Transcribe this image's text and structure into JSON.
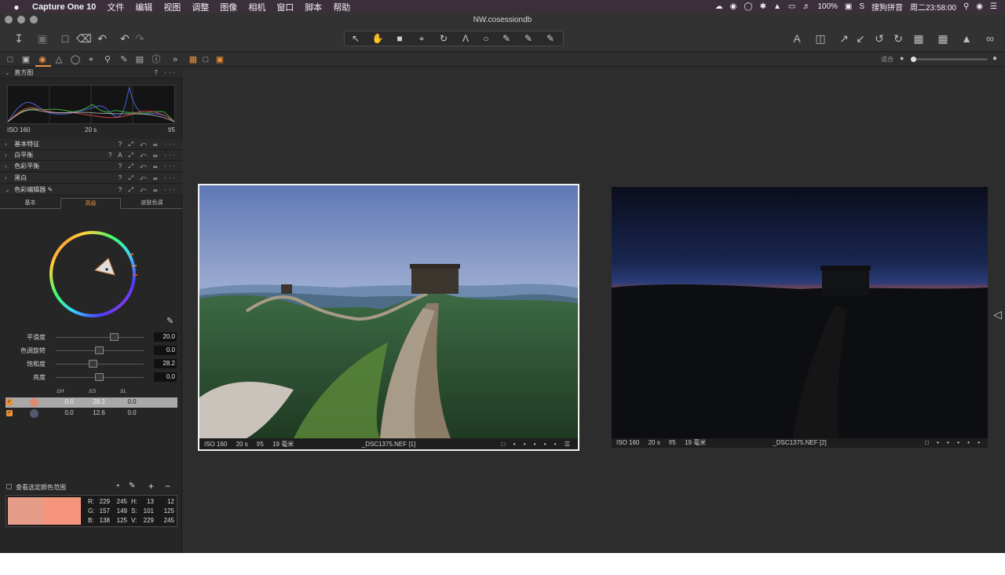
{
  "menubar": {
    "apple": "",
    "app_name": "Capture One 10",
    "menus": [
      "文件",
      "编辑",
      "视图",
      "调整",
      "图像",
      "相机",
      "窗口",
      "脚本",
      "帮助"
    ],
    "battery": "100%",
    "input_method": "搜狗拼音",
    "clock": "周二23:58:00"
  },
  "window": {
    "title": "NW.cosessiondb"
  },
  "colors": {
    "accent": "#e8913a",
    "menubar_bg": "#3a2f3a",
    "panel_bg": "#262626"
  },
  "viewer_bar": {
    "fit_label": "适合"
  },
  "histogram": {
    "title": "直方图",
    "iso": "ISO 160",
    "shutter": "20 s",
    "aperture": "f/5"
  },
  "sections": [
    {
      "title": "基本特征"
    },
    {
      "title": "白平衡"
    },
    {
      "title": "色彩平衡"
    },
    {
      "title": "黑白"
    },
    {
      "title": "色彩编辑器"
    }
  ],
  "color_editor": {
    "tabs": [
      "基本",
      "高级",
      "皮肤色调"
    ],
    "active_tab": 1,
    "sliders": [
      {
        "label": "平滑度",
        "value": "20.0",
        "pos": 0.66
      },
      {
        "label": "色调旋转",
        "value": "0.0",
        "pos": 0.49
      },
      {
        "label": "饱和度",
        "value": "28.2",
        "pos": 0.42
      },
      {
        "label": "亮度",
        "value": "0.0",
        "pos": 0.49
      }
    ],
    "table_headers": [
      "ΔH",
      "ΔS",
      "ΔL"
    ],
    "rows": [
      {
        "dh": "0.0",
        "ds": "28.2",
        "dl": "0.0",
        "color": "#e08a72",
        "selected": true
      },
      {
        "dh": "0.0",
        "ds": "12.6",
        "dl": "0.0",
        "color": "#4e5a6e",
        "selected": false
      }
    ],
    "view_range_label": "查看选定颜色范围"
  },
  "color_readout": {
    "swatch_left": "#e59d8a",
    "swatch_right": "#f5957d",
    "R": [
      "229",
      "245"
    ],
    "G": [
      "157",
      "149"
    ],
    "B": [
      "138",
      "125"
    ],
    "H": [
      "13",
      "12"
    ],
    "S": [
      "101",
      "125"
    ],
    "V": [
      "229",
      "245"
    ]
  },
  "photos": [
    {
      "iso": "ISO 160",
      "shutter": "20 s",
      "aperture": "f/5",
      "focal": "19 毫米",
      "filename": "_DSC1375.NEF [1]",
      "ratings": "• • • • •"
    },
    {
      "iso": "ISO 160",
      "shutter": "20 s",
      "aperture": "f/5",
      "focal": "19 毫米",
      "filename": "_DSC1375.NEF [2]",
      "ratings": "• • • • •"
    }
  ]
}
